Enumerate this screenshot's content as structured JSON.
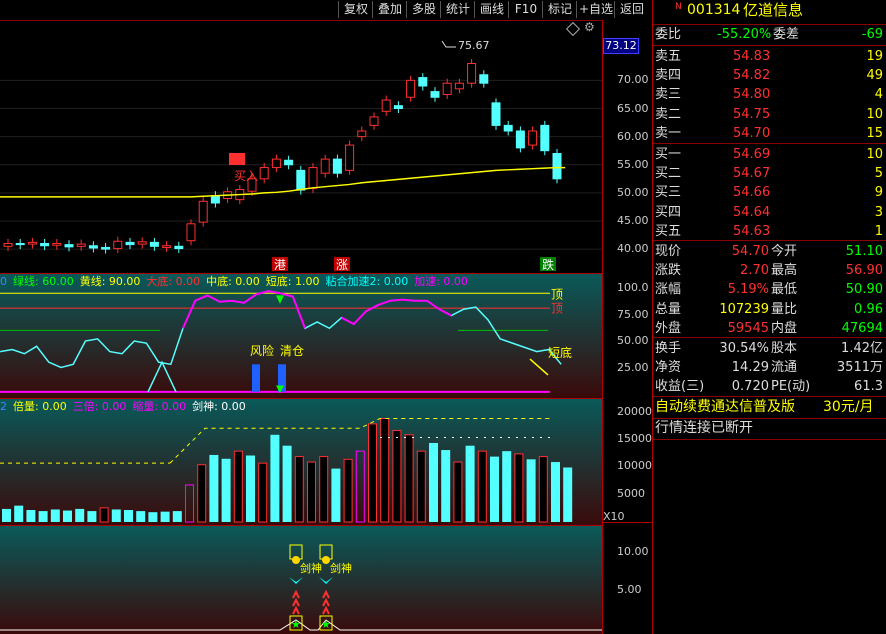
{
  "toolbar": {
    "items": [
      "复权",
      "叠加",
      "多股",
      "统计",
      "画线",
      "F10",
      "标记",
      "+自选",
      "返回"
    ]
  },
  "stock": {
    "marker": "N",
    "code": "001314",
    "name": "亿道信息"
  },
  "price_scale": {
    "current_price_label": "73.12",
    "ticks": [
      "70.00",
      "65.00",
      "60.00",
      "55.00",
      "50.00",
      "45.00",
      "40.00"
    ]
  },
  "main_chart": {
    "high_annotation": "75.67",
    "signal_buy": "买入",
    "markers": [
      {
        "label": "港",
        "color": "#ffffff",
        "bg": "#c00000"
      },
      {
        "label": "涨",
        "color": "#ffffff",
        "bg": "#c00000"
      },
      {
        "label": "跌",
        "color": "#ffffff",
        "bg": "#008000"
      }
    ],
    "ma_color": "#ffff00"
  },
  "chart_data": {
    "type": "candlestick",
    "candles": [
      {
        "o": 40.5,
        "c": 41.0
      },
      {
        "o": 41.0,
        "c": 40.8
      },
      {
        "o": 40.9,
        "c": 41.2
      },
      {
        "o": 41.0,
        "c": 40.6
      },
      {
        "o": 40.7,
        "c": 41.0
      },
      {
        "o": 40.8,
        "c": 40.4
      },
      {
        "o": 40.5,
        "c": 40.9
      },
      {
        "o": 40.6,
        "c": 40.2
      },
      {
        "o": 40.3,
        "c": 40.0
      },
      {
        "o": 40.1,
        "c": 41.4
      },
      {
        "o": 41.2,
        "c": 40.8
      },
      {
        "o": 40.9,
        "c": 41.3
      },
      {
        "o": 41.2,
        "c": 40.5
      },
      {
        "o": 40.3,
        "c": 40.6
      },
      {
        "o": 40.5,
        "c": 40.1
      },
      {
        "o": 41.5,
        "c": 44.5
      },
      {
        "o": 44.8,
        "c": 48.5
      },
      {
        "o": 49.5,
        "c": 48.2
      },
      {
        "o": 49.0,
        "c": 50.2
      },
      {
        "o": 48.8,
        "c": 50.6
      },
      {
        "o": 50.3,
        "c": 52.5
      },
      {
        "o": 52.5,
        "c": 54.5
      },
      {
        "o": 54.5,
        "c": 56.0
      },
      {
        "o": 55.8,
        "c": 55.0
      },
      {
        "o": 54.0,
        "c": 50.5
      },
      {
        "o": 50.8,
        "c": 54.5
      },
      {
        "o": 53.5,
        "c": 56.0
      },
      {
        "o": 56.0,
        "c": 53.5
      },
      {
        "o": 54.0,
        "c": 58.5
      },
      {
        "o": 60.0,
        "c": 61.0
      },
      {
        "o": 62.0,
        "c": 63.5
      },
      {
        "o": 64.5,
        "c": 66.5
      },
      {
        "o": 65.5,
        "c": 65.0
      },
      {
        "o": 67.0,
        "c": 70.0
      },
      {
        "o": 70.5,
        "c": 69.0
      },
      {
        "o": 68.0,
        "c": 67.0
      },
      {
        "o": 67.5,
        "c": 69.5
      },
      {
        "o": 68.5,
        "c": 69.5
      },
      {
        "o": 69.5,
        "c": 73.0
      },
      {
        "o": 71.0,
        "c": 69.5
      },
      {
        "o": 66.0,
        "c": 62.0
      },
      {
        "o": 62.0,
        "c": 61.0
      },
      {
        "o": 61.0,
        "c": 58.0
      },
      {
        "o": 58.5,
        "c": 61.0
      },
      {
        "o": 62.0,
        "c": 57.5
      },
      {
        "o": 57.0,
        "c": 52.5
      }
    ],
    "ma": [
      49.3,
      49.3,
      49.3,
      49.3,
      49.3,
      49.3,
      49.3,
      49.3,
      49.3,
      49.3,
      49.3,
      49.3,
      49.3,
      49.3,
      49.3,
      49.3,
      49.4,
      49.5,
      49.6,
      49.7,
      49.8,
      50.0,
      50.1,
      50.3,
      50.6,
      50.9,
      51.1,
      51.3,
      51.5,
      51.8,
      52.0,
      52.2,
      52.4,
      52.6,
      52.8,
      53.0,
      53.2,
      53.4,
      53.6,
      53.8,
      54.0,
      54.1,
      54.2,
      54.3,
      54.4,
      54.5
    ],
    "ylim": [
      37,
      77
    ]
  },
  "indicator1": {
    "prefix": "0",
    "legend": [
      {
        "text": "绿线: 60.00",
        "color": "#00ff00"
      },
      {
        "text": "黄线: 90.00",
        "color": "#ffff00"
      },
      {
        "text": "大底: 0.00",
        "color": "#ff3030"
      },
      {
        "text": "中底: 0.00",
        "color": "#ffff00"
      },
      {
        "text": "短底: 1.00",
        "color": "#ffff00"
      },
      {
        "text": "粘合加速2: 0.00",
        "color": "#00ffff"
      },
      {
        "text": "加速: 0.00",
        "color": "#ff00ff"
      }
    ],
    "ticks": [
      "100.0",
      "75.00",
      "50.00",
      "25.00"
    ],
    "label_top": "顶",
    "label_top2": "顶",
    "label_bottom": "短底",
    "risk": "风险",
    "clear": "清仓",
    "values": [
      40,
      42,
      38,
      45,
      30,
      25,
      28,
      50,
      52,
      40,
      38,
      50,
      48,
      30,
      28,
      62,
      88,
      93,
      87,
      88,
      86,
      94,
      97,
      95,
      92,
      62,
      68,
      62,
      72,
      66,
      78,
      84,
      88,
      89,
      88,
      88,
      80,
      74,
      80,
      82,
      70,
      52,
      48,
      44,
      40,
      42,
      28
    ]
  },
  "indicator2": {
    "prefix": "2",
    "legend": [
      {
        "text": "倍量: 0.00",
        "color": "#ffff00"
      },
      {
        "text": "三倍: 0.00",
        "color": "#ff00ff"
      },
      {
        "text": "缩量: 0.00",
        "color": "#ff00ff"
      },
      {
        "text": "剑神: 0.00",
        "color": "#ffffff"
      }
    ],
    "ticks": [
      "20000",
      "15000",
      "10000",
      "5000"
    ],
    "unit": "X10",
    "volumes": [
      2400,
      3000,
      2200,
      2000,
      2300,
      2100,
      2400,
      2000,
      2600,
      2300,
      2200,
      2000,
      1800,
      1900,
      2000,
      6800,
      10500,
      12300,
      11600,
      13000,
      12200,
      10800,
      16000,
      14000,
      12000,
      11000,
      12000,
      9800,
      11500,
      13000,
      18000,
      19000,
      16800,
      16000,
      13000,
      14500,
      13200,
      11000,
      14000,
      13000,
      12000,
      13000,
      12500,
      11500,
      12000,
      11000,
      10000
    ],
    "vol_colors": [
      "c",
      "c",
      "c",
      "c",
      "c",
      "c",
      "c",
      "c",
      "r",
      "c",
      "c",
      "c",
      "c",
      "c",
      "c",
      "m",
      "r",
      "c",
      "c",
      "r",
      "c",
      "r",
      "c",
      "c",
      "r",
      "r",
      "r",
      "c",
      "r",
      "m",
      "r",
      "r",
      "r",
      "r",
      "r",
      "c",
      "c",
      "r",
      "c",
      "r",
      "c",
      "c",
      "r",
      "c",
      "r",
      "c",
      "c"
    ]
  },
  "indicator3": {
    "ticks": [
      "10.00",
      "5.00"
    ],
    "jianshen": "剑神"
  },
  "quote": {
    "weibi_label": "委比",
    "weibi_value": "-55.20%",
    "weicha_label": "委差",
    "weicha_value": "-69",
    "sells": [
      {
        "label": "卖五",
        "price": "54.83",
        "vol": "19"
      },
      {
        "label": "卖四",
        "price": "54.82",
        "vol": "49"
      },
      {
        "label": "卖三",
        "price": "54.80",
        "vol": "4"
      },
      {
        "label": "卖二",
        "price": "54.75",
        "vol": "10"
      },
      {
        "label": "卖一",
        "price": "54.70",
        "vol": "15"
      }
    ],
    "buys": [
      {
        "label": "买一",
        "price": "54.69",
        "vol": "10"
      },
      {
        "label": "买二",
        "price": "54.67",
        "vol": "5"
      },
      {
        "label": "买三",
        "price": "54.66",
        "vol": "9"
      },
      {
        "label": "买四",
        "price": "54.64",
        "vol": "3"
      },
      {
        "label": "买五",
        "price": "54.63",
        "vol": "1"
      }
    ],
    "stats": [
      {
        "l1": "现价",
        "v1": "54.70",
        "c1": "#ff3030",
        "l2": "今开",
        "v2": "51.10",
        "c2": "#00ff00"
      },
      {
        "l1": "涨跌",
        "v1": "2.70",
        "c1": "#ff3030",
        "l2": "最高",
        "v2": "56.90",
        "c2": "#ff3030"
      },
      {
        "l1": "涨幅",
        "v1": "5.19%",
        "c1": "#ff3030",
        "l2": "最低",
        "v2": "50.90",
        "c2": "#00ff00"
      },
      {
        "l1": "总量",
        "v1": "107239",
        "c1": "#ffff00",
        "l2": "量比",
        "v2": "0.96",
        "c2": "#00ff00"
      },
      {
        "l1": "外盘",
        "v1": "59545",
        "c1": "#ff3030",
        "l2": "内盘",
        "v2": "47694",
        "c2": "#00ff00"
      }
    ],
    "stats2": [
      {
        "l1": "换手",
        "v1": "30.54%",
        "l2": "股本",
        "v2": "1.42亿"
      },
      {
        "l1": "净资",
        "v1": "14.29",
        "l2": "流通",
        "v2": "3511万"
      },
      {
        "l1": "收益(三)",
        "v1": "0.720",
        "l2": "PE(动)",
        "v2": "61.3"
      }
    ],
    "ad_text": "自动续费通达信普及版",
    "ad_price": "30元/月",
    "status": "行情连接已断开"
  }
}
